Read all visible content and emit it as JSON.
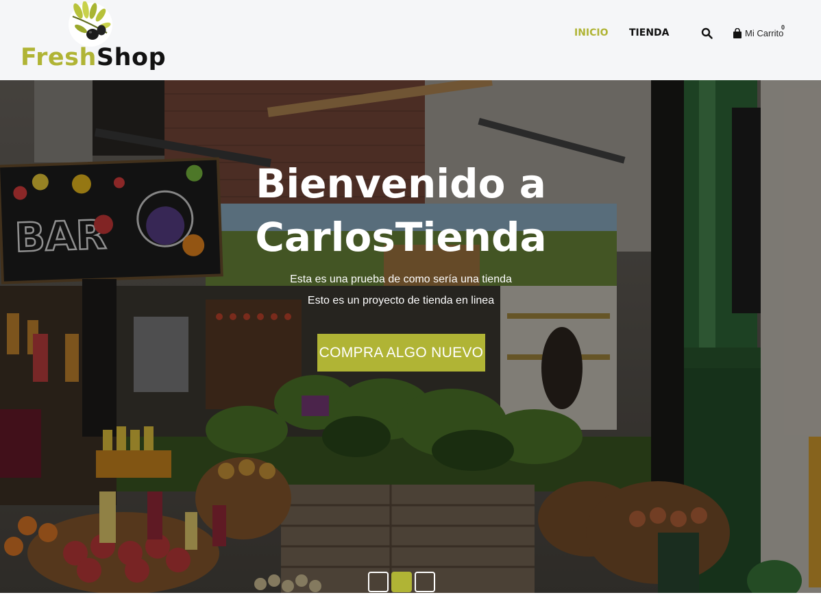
{
  "brand": {
    "name_part1": "Fresh",
    "name_part2": "Shop",
    "logo_icon": "olive-branch-icon"
  },
  "nav": {
    "items": [
      {
        "label": "INICIO",
        "active": true
      },
      {
        "label": "TIENDA",
        "active": false
      }
    ],
    "search_icon": "search-icon",
    "cart": {
      "icon": "shopping-bag-icon",
      "label": "Mi Carrito",
      "count": "0"
    }
  },
  "hero": {
    "title_line1": "Bienvenido a",
    "title_line2": "CarlosTienda",
    "subtitle1": "Esta es una prueba de como sería una tienda",
    "subtitle2": "Esto es un proyecto de tienda en linea",
    "button_label": "COMPRA ALGO NUEVO",
    "background": "market-stall-photo",
    "slides": 3,
    "active_slide": 2
  },
  "colors": {
    "accent": "#b0b435",
    "header_bg": "#f5f6f8",
    "text_dark": "#111111"
  }
}
